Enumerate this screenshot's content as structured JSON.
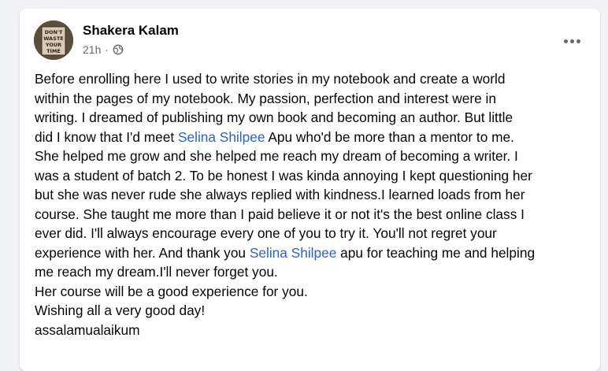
{
  "post": {
    "author": "Shakera Kalam",
    "time": "21h",
    "separator": "·",
    "privacy_icon": "globe-icon",
    "more_icon": "more-horizontal-icon",
    "avatar_icon": "book-cover-avatar",
    "avatar_text": [
      "DON'T",
      "WASTE",
      "YOUR",
      "TIME"
    ],
    "colors": {
      "mention": "#2a63c6",
      "text": "#050505",
      "meta": "#65676b"
    },
    "lines": [
      [
        "Before enrolling here I used to write stories in my notebook and create a world"
      ],
      [
        "within the pages of my notebook. My passion, perfection and interest were in"
      ],
      [
        "writing. I dreamed of publishing my own book and becoming an author. But little"
      ],
      [
        "did I know that I'd meet ",
        "Selina Shilpee",
        " Apu who'd be more than a mentor to me."
      ],
      [
        "She helped me grow and she helped me reach my dream of becoming a writer. I"
      ],
      [
        "was a student of batch 2. To be honest I was kinda annoying I kept questioning her"
      ],
      [
        "but she was never rude she always replied with kindness.I learned loads from her"
      ],
      [
        "course. She taught me more than I paid believe it or not it's the best online class I"
      ],
      [
        "ever did. I'll always encourage every one of  you to try it. You'll not regret your"
      ],
      [
        "experience with her. And thank you ",
        "Selina Shilpee",
        " apu for teaching me and helping"
      ],
      [
        "me reach my dream.I'll never forget you."
      ],
      [
        "Her course will be a good experience for you."
      ],
      [
        "Wishing all a very good day!"
      ],
      [
        "assalamualaikum"
      ]
    ]
  }
}
